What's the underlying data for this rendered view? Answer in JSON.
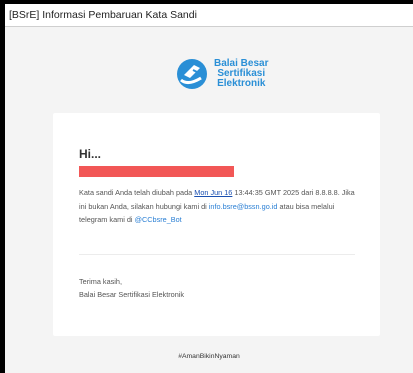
{
  "window": {
    "title": "[BSrE] Informasi Pembaruan Kata Sandi"
  },
  "logo": {
    "icon": "bsre-logo-icon",
    "lines": [
      "Balai Besar",
      "Sertifikasi",
      "Elektronik"
    ],
    "color": "#2a8fd6"
  },
  "email": {
    "greeting": "Hi...",
    "redacted_color": "#f25756",
    "message": {
      "part1": "Kata sandi Anda telah diubah pada ",
      "date_link": "Mon Jun 16",
      "part2": " 13:44:35 GMT 2025 dari 8.8.8.8. Jika ini bukan Anda, silakan hubungi kami di ",
      "email_link": "info.bsre@bssn.go.id",
      "part3": " atau bisa melalui telegram kami di ",
      "telegram_link": "@CCbsre_Bot"
    },
    "signoff": "Terima kasih,",
    "sender": "Balai Besar Sertifikasi Elektronik"
  },
  "footer": {
    "hashtag": "#AmanBikinNyaman"
  }
}
